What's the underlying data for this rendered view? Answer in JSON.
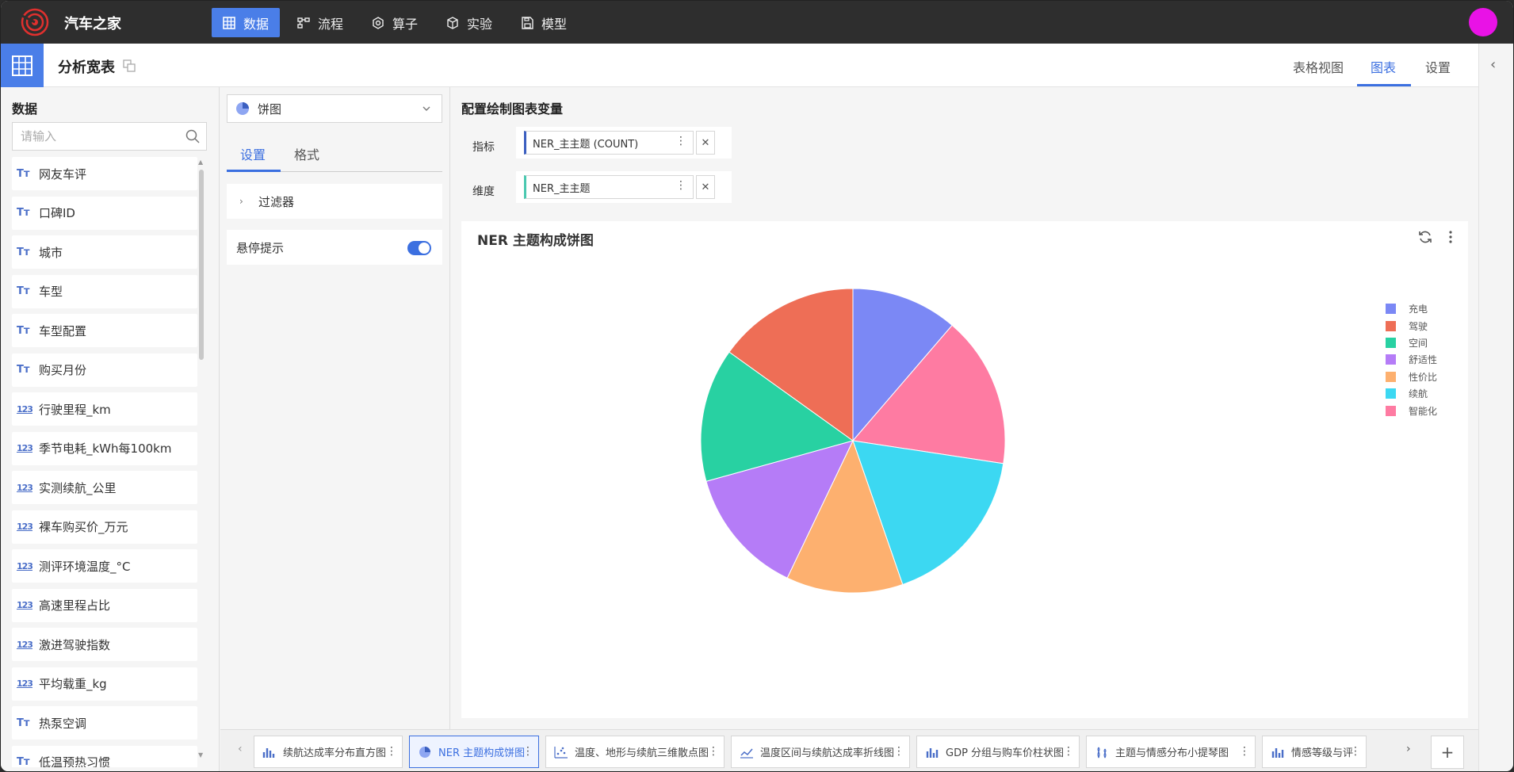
{
  "app": {
    "title": "汽车之家"
  },
  "nav": {
    "tabs": [
      {
        "label": "数据",
        "icon": "table-icon"
      },
      {
        "label": "流程",
        "icon": "flow-icon"
      },
      {
        "label": "算子",
        "icon": "gear-icon"
      },
      {
        "label": "实验",
        "icon": "cube-icon"
      },
      {
        "label": "模型",
        "icon": "save-icon"
      }
    ],
    "active": "数据"
  },
  "page": {
    "title": "分析宽表",
    "views": [
      "表格视图",
      "图表",
      "设置"
    ],
    "active_view": "图表"
  },
  "data_panel": {
    "heading": "数据",
    "search_placeholder": "请输入",
    "fields": [
      {
        "type": "Tт",
        "name": "网友车评"
      },
      {
        "type": "Tт",
        "name": "口碑ID"
      },
      {
        "type": "Tт",
        "name": "城市"
      },
      {
        "type": "Tт",
        "name": "车型"
      },
      {
        "type": "Tт",
        "name": "车型配置"
      },
      {
        "type": "Tт",
        "name": "购买月份"
      },
      {
        "type": "123",
        "name": "行驶里程_km"
      },
      {
        "type": "123",
        "name": "季节电耗_kWh每100km"
      },
      {
        "type": "123",
        "name": "实测续航_公里"
      },
      {
        "type": "123",
        "name": "裸车购买价_万元"
      },
      {
        "type": "123",
        "name": "测评环境温度_°C"
      },
      {
        "type": "123",
        "name": "高速里程占比"
      },
      {
        "type": "123",
        "name": "激进驾驶指数"
      },
      {
        "type": "123",
        "name": "平均载重_kg"
      },
      {
        "type": "Tт",
        "name": "热泵空调"
      },
      {
        "type": "Tт",
        "name": "低温预热习惯"
      }
    ]
  },
  "settings_panel": {
    "chart_type": "饼图",
    "tabs": [
      "设置",
      "格式"
    ],
    "active_tab": "设置",
    "filter_label": "过滤器",
    "tooltip_label": "悬停提示",
    "tooltip_on": true
  },
  "config": {
    "title": "配置绘制图表变量",
    "metric_label": "指标",
    "metric_value": "NER_主主题 (COUNT)",
    "dimension_label": "维度",
    "dimension_value": "NER_主主题"
  },
  "chart_data": {
    "type": "pie",
    "title": "NER 主题构成饼图",
    "categories": [
      "充电",
      "驾驶",
      "空间",
      "舒适性",
      "性价比",
      "续航",
      "智能化"
    ],
    "values": [
      11.3,
      15.1,
      14.2,
      13.6,
      12.4,
      17.3,
      16.1
    ],
    "colors": [
      "#7b88f5",
      "#ee6e56",
      "#28d1a2",
      "#b57cf7",
      "#fdb06f",
      "#3cd8f2",
      "#fe7ba2"
    ],
    "draw_order": [
      "充电",
      "智能化",
      "续航",
      "性价比",
      "舒适性",
      "空间",
      "驾驶"
    ],
    "legend_position": "right"
  },
  "bottom_tabs": [
    {
      "label": "续航达成率分布直方图",
      "icon": "histogram-icon"
    },
    {
      "label": "NER 主题构成饼图",
      "icon": "pie-icon",
      "active": true
    },
    {
      "label": "温度、地形与续航三维散点图",
      "icon": "scatter-icon"
    },
    {
      "label": "温度区间与续航达成率折线图",
      "icon": "line-icon"
    },
    {
      "label": "GDP 分组与购车价柱状图",
      "icon": "bar-icon"
    },
    {
      "label": "主题与情感分布小提琴图",
      "icon": "violin-icon"
    },
    {
      "label": "情感等级与评",
      "icon": "bar-icon"
    }
  ]
}
